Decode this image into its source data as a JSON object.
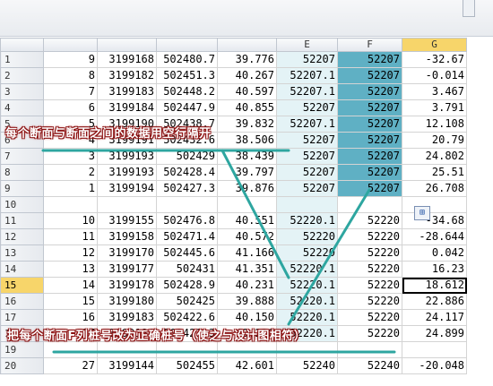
{
  "sheet": {
    "columns": [
      "",
      "",
      "",
      "",
      "",
      "E",
      "F",
      "G"
    ],
    "active_row": 15,
    "rows": [
      {
        "n": "1",
        "c": [
          "9",
          "3199168",
          "502480.7",
          "39.776",
          "52207",
          "52207",
          "-32.67"
        ]
      },
      {
        "n": "2",
        "c": [
          "8",
          "3199182",
          "502451.3",
          "40.267",
          "52207.1",
          "52207",
          "-0.014"
        ]
      },
      {
        "n": "3",
        "c": [
          "7",
          "3199183",
          "502448.2",
          "40.597",
          "52207.1",
          "52207",
          "3.467"
        ]
      },
      {
        "n": "4",
        "c": [
          "6",
          "3199184",
          "502447.9",
          "40.855",
          "52207",
          "52207",
          "3.791"
        ]
      },
      {
        "n": "5",
        "c": [
          "5",
          "3199190",
          "502438.7",
          "39.832",
          "52207.1",
          "52207",
          "12.108"
        ]
      },
      {
        "n": "6",
        "c": [
          "4",
          "3199191",
          "502432.6",
          "38.506",
          "52207",
          "52207",
          "20.79"
        ]
      },
      {
        "n": "7",
        "c": [
          "3",
          "3199193",
          "502429",
          "38.439",
          "52207",
          "52207",
          "24.802"
        ]
      },
      {
        "n": "8",
        "c": [
          "2",
          "3199193",
          "502428.4",
          "39.797",
          "52207",
          "52207",
          "25.51"
        ]
      },
      {
        "n": "9",
        "c": [
          "1",
          "3199194",
          "502427.3",
          "39.876",
          "52207",
          "52207",
          "26.708"
        ]
      },
      {
        "n": "10",
        "c": [
          "",
          "",
          "",
          "",
          "",
          "",
          ""
        ]
      },
      {
        "n": "11",
        "c": [
          "10",
          "3199155",
          "502476.8",
          "40.551",
          "52220.1",
          "52220",
          "-34.68"
        ]
      },
      {
        "n": "12",
        "c": [
          "11",
          "3199158",
          "502471.4",
          "40.572",
          "52220",
          "52220",
          "-28.644"
        ]
      },
      {
        "n": "13",
        "c": [
          "12",
          "3199170",
          "502445.6",
          "41.166",
          "52220",
          "52220",
          "0.042"
        ]
      },
      {
        "n": "14",
        "c": [
          "13",
          "3199177",
          "502431",
          "41.351",
          "52220.1",
          "52220",
          "16.23"
        ]
      },
      {
        "n": "15",
        "c": [
          "14",
          "3199178",
          "502428.9",
          "40.231",
          "52220.1",
          "52220",
          "18.612"
        ]
      },
      {
        "n": "16",
        "c": [
          "15",
          "3199180",
          "502425",
          "39.888",
          "52220.1",
          "52220",
          "22.886"
        ]
      },
      {
        "n": "17",
        "c": [
          "16",
          "3199183",
          "502422.6",
          "40.150",
          "52220.1",
          "52220",
          "24.117"
        ]
      },
      {
        "n": "18",
        "c": [
          "17",
          "3199184",
          "502421.3",
          "40.236",
          "52220.1",
          "52220",
          "24.899"
        ]
      },
      {
        "n": "19",
        "c": [
          "",
          "",
          "",
          "",
          "",
          "",
          ""
        ]
      },
      {
        "n": "20",
        "c": [
          "27",
          "3199144",
          "502455",
          "42.601",
          "52240",
          "52240",
          "-20.048"
        ]
      }
    ]
  },
  "annotations": {
    "top": "每个断面与断面之间的数据用空行隔开",
    "bottom": "把每个断面F列桩号改为正确桩号（使之与设计图相符）"
  },
  "paste_options_glyph": "⊞",
  "colors": {
    "e_selection": "#e4f3f6",
    "f_selection": "#5fb0c4",
    "annotation_line": "#2ea6a0",
    "annotation_text_outline": "#8a1010"
  }
}
